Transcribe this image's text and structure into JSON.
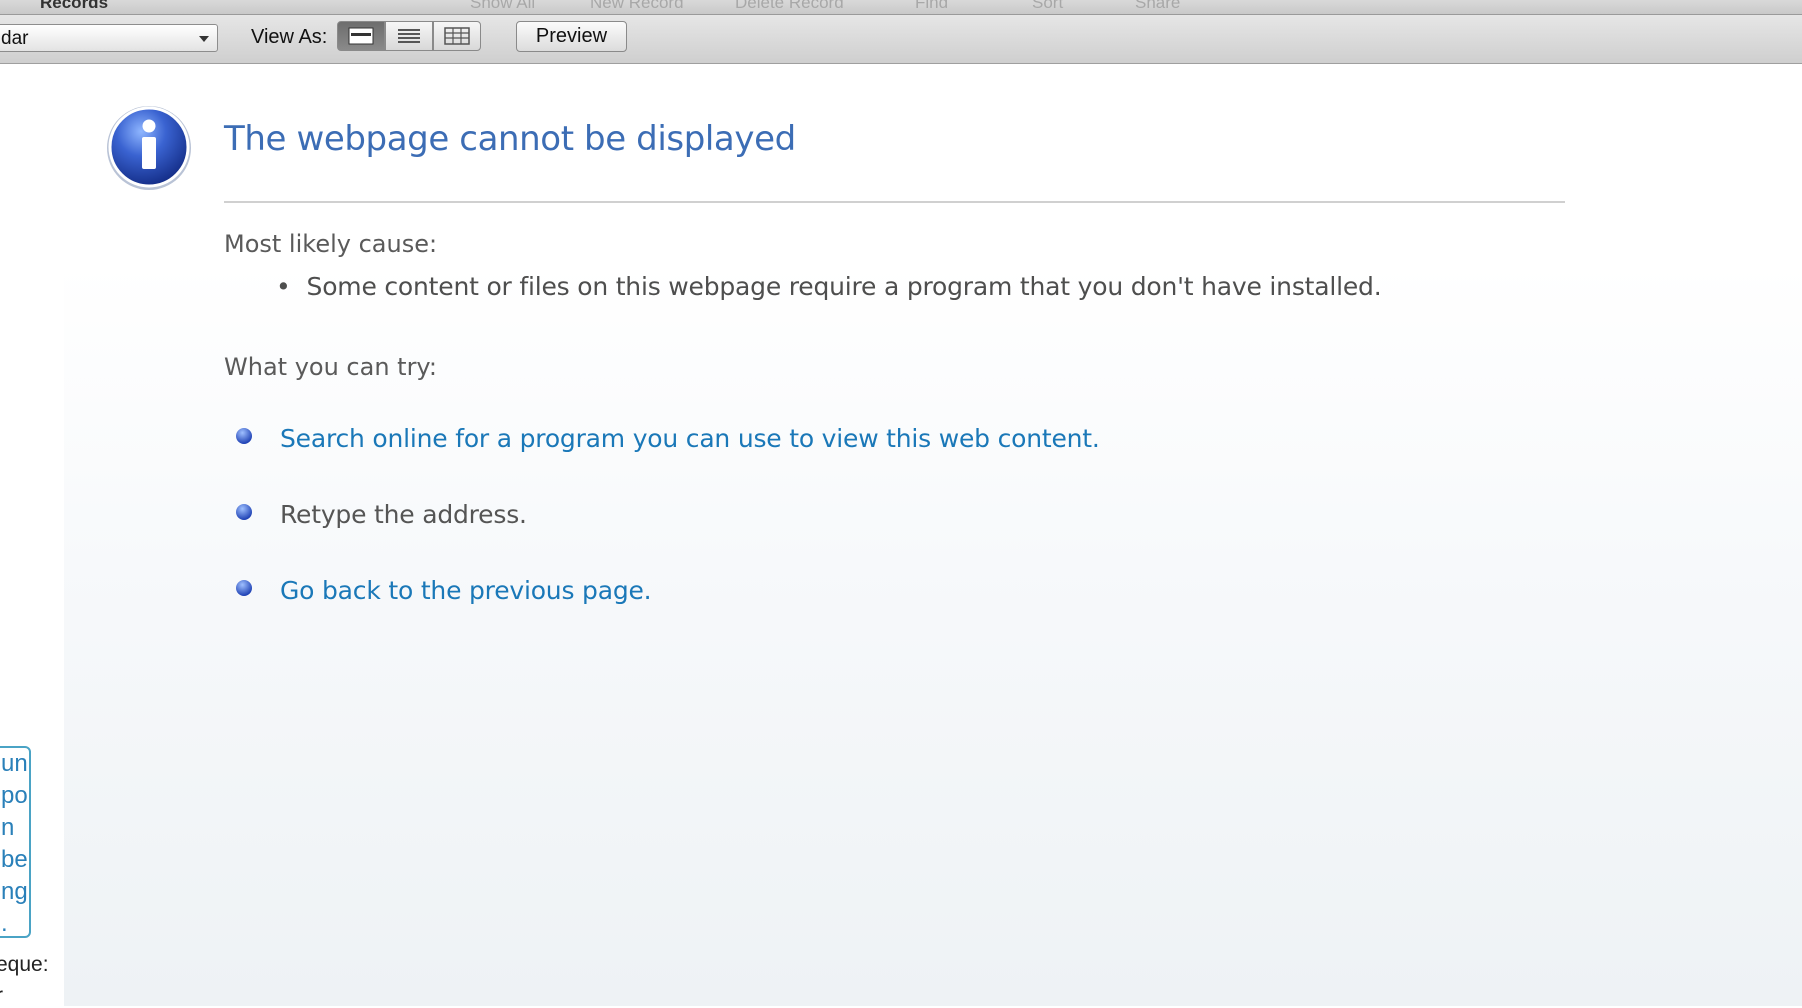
{
  "top_toolbar": {
    "records_menu": "Records",
    "items": [
      "Show All",
      "New Record",
      "Delete Record",
      "Find",
      "Sort",
      "Share"
    ]
  },
  "toolbar": {
    "layout_select_value": "dar",
    "view_as_label": "View As:",
    "view_modes": [
      {
        "name": "form-view-icon",
        "active": true
      },
      {
        "name": "list-view-icon",
        "active": false
      },
      {
        "name": "table-view-icon",
        "active": false
      }
    ],
    "preview_label": "Preview"
  },
  "error_page": {
    "title": "The webpage cannot be displayed",
    "cause_heading": "Most likely cause:",
    "cause_bullet": "•",
    "cause_item": "Some content or files on this webpage require a program that you don't have installed.",
    "try_heading": "What you can try:",
    "options": [
      {
        "text": "Search online for a program you can use to view this web content.",
        "link": true
      },
      {
        "text": "Retype the address.",
        "link": false
      },
      {
        "text": "Go back to the previous page.",
        "link": true
      }
    ]
  },
  "side_panel": {
    "frame_lines": [
      "un",
      "po",
      "n",
      "be",
      "ng",
      "."
    ],
    "text_lines": [
      "eque:",
      "r"
    ]
  },
  "colors": {
    "title": "#3c6db5",
    "link": "#1a78b8",
    "text": "#555555",
    "frame": "#4aa3c5"
  }
}
